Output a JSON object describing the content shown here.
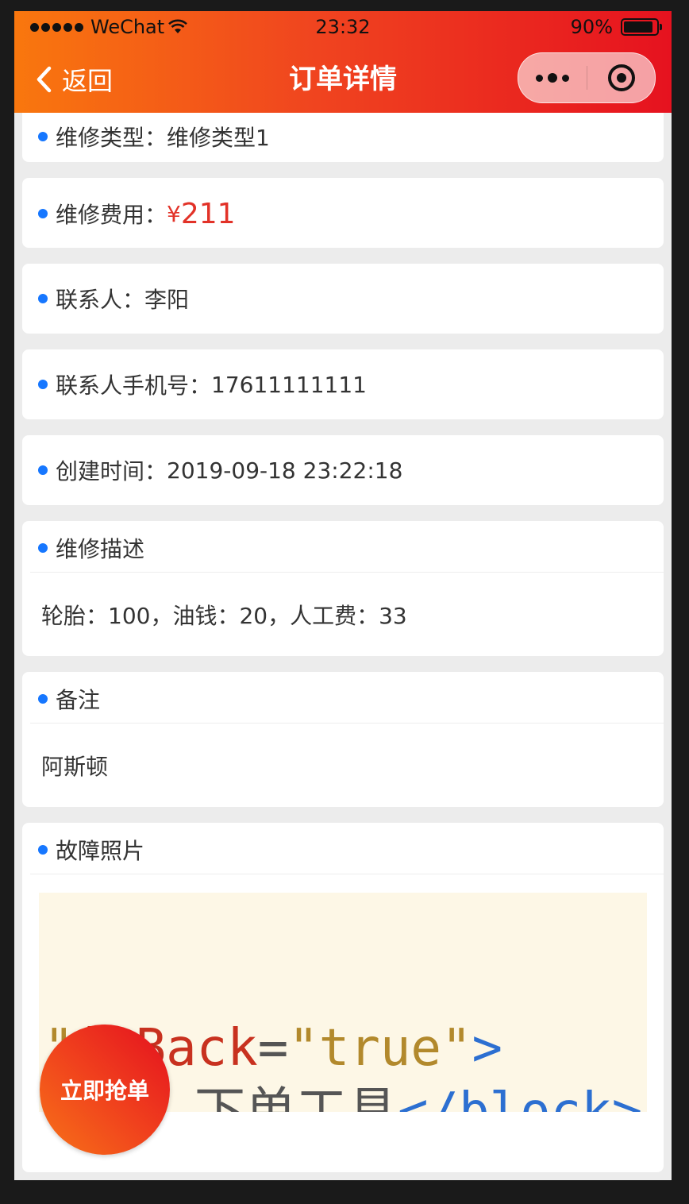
{
  "status_bar": {
    "carrier": "WeChat",
    "time": "23:32",
    "battery_text": "90%",
    "battery_level": 0.9
  },
  "nav": {
    "back_label": "返回",
    "title": "订单详情"
  },
  "fields": {
    "repair_type": {
      "label": "维修类型：",
      "value": "维修类型1"
    },
    "repair_cost": {
      "label": "维修费用：",
      "currency": "¥",
      "value": "211"
    },
    "contact": {
      "label": "联系人：",
      "value": "李阳"
    },
    "contact_phone": {
      "label": "联系人手机号：",
      "value": "17611111111"
    },
    "created_time": {
      "label": "创建时间：",
      "value": "2019-09-18 23:22:18"
    }
  },
  "sections": {
    "description": {
      "title": "维修描述",
      "content": "轮胎：100，油钱：20，人工费：33"
    },
    "remarks": {
      "title": "备注",
      "content": "阿斯顿"
    },
    "photos": {
      "title": "故障照片",
      "photo_text": {
        "line1": {
          "quote": "\"",
          "attr": "isBack",
          "eq": "=",
          "value": "\"true\"",
          "close": ">"
        },
        "line2": {
          "text": "下单工具",
          "tag": "</block>"
        }
      }
    }
  },
  "actions": {
    "grab_order": "立即抢单"
  },
  "colors": {
    "accent": "#e23228",
    "bullet": "#1677ff",
    "header_start": "#f9770e",
    "header_end": "#e6121f"
  }
}
